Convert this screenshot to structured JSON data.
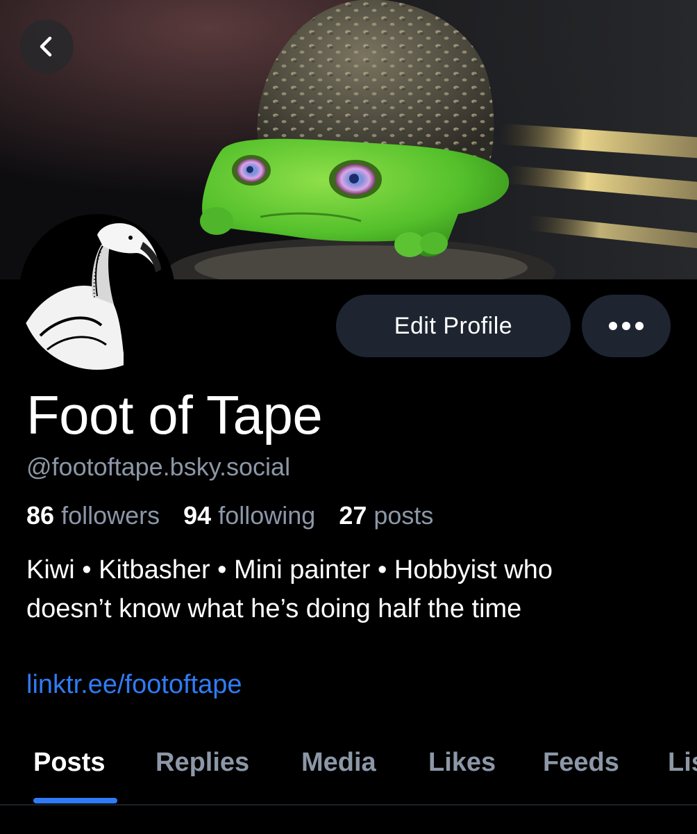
{
  "banner": {
    "description_icon": "banner-image",
    "back_icon": "chevron-left-icon"
  },
  "avatar": {
    "icon": "vulture-avatar-image"
  },
  "actions": {
    "edit_profile_label": "Edit Profile",
    "more_icon": "ellipsis-icon"
  },
  "profile": {
    "display_name": "Foot of Tape",
    "handle": "@footoftape.bsky.social",
    "stats": {
      "followers_count": "86",
      "followers_label": "followers",
      "following_count": "94",
      "following_label": "following",
      "posts_count": "27",
      "posts_label": "posts"
    },
    "bio_line1": "Kiwi • Kitbasher • Mini painter • Hobbyist who",
    "bio_line2": "doesn’t know what he’s doing half the time",
    "link": "linktr.ee/footoftape"
  },
  "tabs": [
    {
      "label": "Posts",
      "active": true
    },
    {
      "label": "Replies",
      "active": false
    },
    {
      "label": "Media",
      "active": false
    },
    {
      "label": "Likes",
      "active": false
    },
    {
      "label": "Feeds",
      "active": false
    },
    {
      "label": "Lists",
      "active": false
    }
  ],
  "colors": {
    "background": "#000000",
    "accent": "#2f7cf6",
    "muted_text": "#8c97a7",
    "button_bg": "#1e2530"
  }
}
